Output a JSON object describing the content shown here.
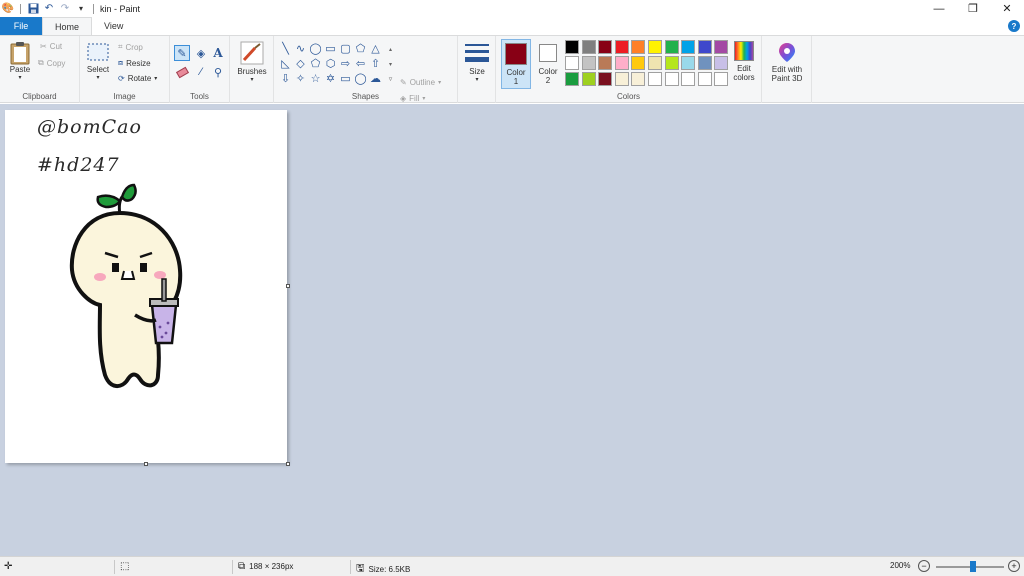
{
  "window": {
    "title": "kin - Paint",
    "minimize": "—",
    "restore": "❐",
    "close": "✕"
  },
  "tabs": [
    {
      "label": "File"
    },
    {
      "label": "Home"
    },
    {
      "label": "View"
    }
  ],
  "help": "?",
  "ribbon": {
    "clipboard": {
      "paste": "Paste",
      "cut": "Cut",
      "copy": "Copy",
      "group": "Clipboard"
    },
    "image": {
      "select": "Select",
      "crop": "Crop",
      "resize": "Resize",
      "rotate": "Rotate",
      "group": "Image"
    },
    "tools": {
      "group": "Tools",
      "text_glyph": "A"
    },
    "brushes": {
      "label": "Brushes"
    },
    "shapes": {
      "outline": "Outline",
      "fill": "Fill",
      "group": "Shapes"
    },
    "size": {
      "label": "Size"
    },
    "color1": {
      "label1": "Color",
      "label2": "1",
      "value": "#880015"
    },
    "color2": {
      "label1": "Color",
      "label2": "2",
      "value": "#ffffff"
    },
    "colors_group": "Colors",
    "edit_colors": {
      "line1": "Edit",
      "line2": "colors"
    },
    "paint3d": {
      "line1": "Edit with",
      "line2": "Paint 3D"
    }
  },
  "palette": {
    "row1": [
      "#000000",
      "#7f7f7f",
      "#880015",
      "#ed1c24",
      "#ff7f27",
      "#fff200",
      "#22b14c",
      "#00a2e8",
      "#3f48cc",
      "#a349a4"
    ],
    "row2": [
      "#ffffff",
      "#c3c3c3",
      "#b97a57",
      "#ffaec9",
      "#ffc90e",
      "#efe4b0",
      "#b5e61d",
      "#99d9ea",
      "#7092be",
      "#c8bfe7"
    ],
    "row3": [
      "#1a9c3f",
      "#9ed020",
      "#7a0f1f",
      "#f8f0d8",
      "#f8f0d8",
      "#ffffff",
      "#ffffff",
      "#ffffff",
      "#ffffff",
      "#ffffff"
    ]
  },
  "canvas": {
    "line1": "@bomCao",
    "line2": "#hd247"
  },
  "status": {
    "dimensions": "188 × 236px",
    "size": "Size: 6.5KB",
    "zoom": "200%",
    "zoom_out": "−",
    "zoom_in": "+",
    "zoom_level": 0.55
  }
}
